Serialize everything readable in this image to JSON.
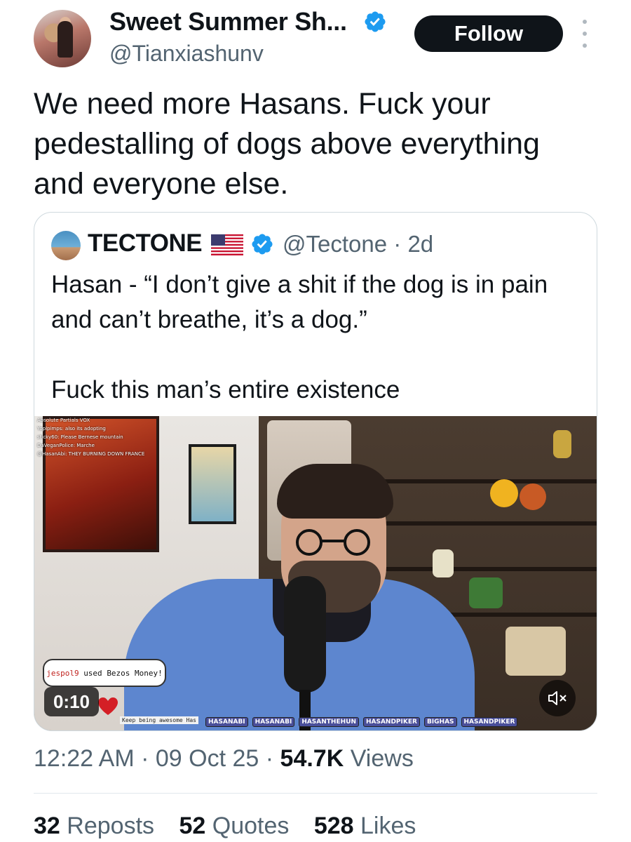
{
  "tweet": {
    "author": {
      "display_name": "Sweet Summer Sh...",
      "handle": "@Tianxiashunv",
      "verified": true
    },
    "follow_label": "Follow",
    "text": "We need more Hasans. Fuck your pedestalling of dogs above everything and everyone else."
  },
  "quote": {
    "author": {
      "display_name": "TECTONE",
      "handle": "@Tectone",
      "separator": "·",
      "age": "2d",
      "flag_icon": "us-flag-icon",
      "verified": true
    },
    "text_line1": "Hasan - “I don’t give a shit if the dog is in pain and can’t breathe, it’s a dog.”",
    "text_line2": "Fuck this man’s entire existence",
    "video": {
      "timestamp": "0:10",
      "chat_lines": [
        "Absolute Partials     VOX",
        "Yoplpimps: also its adopting",
        "sticky60: Please Bernese mountain",
        "DaVeganPolice:        Marche",
        "@HasanAbi: THEY BURNING DOWN FRANCE"
      ],
      "donation_user": "jespol9",
      "donation_action": "used",
      "donation_item": "Bezos Money!",
      "caption": "Keep being awesome Has",
      "social_tags": [
        "HASANABI",
        "HASANABI",
        "HASANTHEHUN",
        "HASANDPIKER",
        "BIGHAS",
        "HASANDPIKER"
      ]
    }
  },
  "meta": {
    "time": "12:22 AM",
    "sep1": "·",
    "date": "09 Oct 25",
    "sep2": "·",
    "views_count": "54.7K",
    "views_label": "Views"
  },
  "stats": {
    "reposts_count": "32",
    "reposts_label": "Reposts",
    "quotes_count": "52",
    "quotes_label": "Quotes",
    "likes_count": "528",
    "likes_label": "Likes"
  },
  "colors": {
    "verified_blue": "#1d9bf0",
    "text_primary": "#0f1419",
    "text_secondary": "#536471",
    "border": "#cfd9de"
  }
}
